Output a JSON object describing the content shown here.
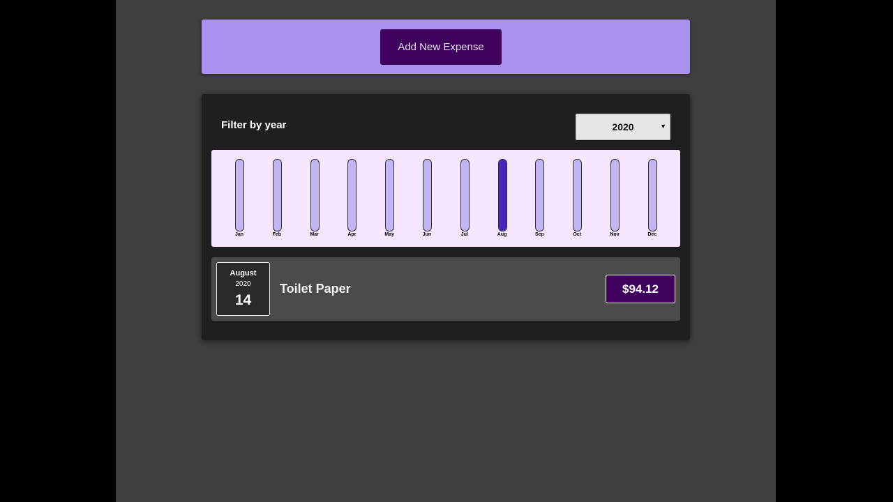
{
  "header": {
    "add_button_label": "Add New Expense"
  },
  "filter": {
    "label": "Filter by year",
    "selected_year": "2020",
    "chevron_icon": "chevron-down-icon"
  },
  "chart_data": {
    "type": "bar",
    "categories": [
      "Jan",
      "Feb",
      "Mar",
      "Apr",
      "May",
      "Jun",
      "Jul",
      "Aug",
      "Sep",
      "Oct",
      "Nov",
      "Dec"
    ],
    "values": [
      0,
      0,
      0,
      0,
      0,
      0,
      0,
      94.12,
      0,
      0,
      0,
      0
    ],
    "ylim": [
      0,
      94.12
    ],
    "grid": false
  },
  "expenses": [
    {
      "month": "August",
      "year": "2020",
      "day": "14",
      "title": "Toilet Paper",
      "amount": "$94.12"
    }
  ],
  "colors": {
    "accent": "#40005d",
    "header_bg": "#a892ee",
    "chart_bg": "#f7e6ff",
    "bar_track": "#c3b4f3",
    "bar_fill": "#4826b9"
  }
}
